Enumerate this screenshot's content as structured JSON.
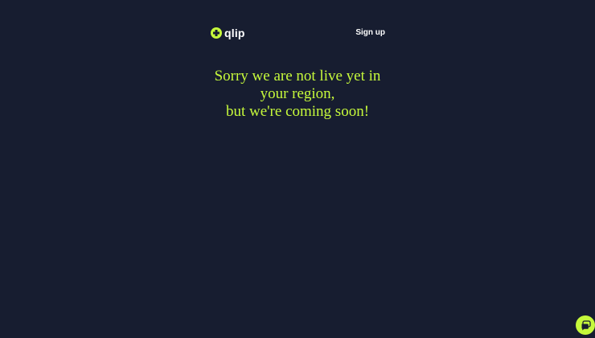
{
  "brand": {
    "name": "qlip",
    "logo_icon": "plus-circle-icon",
    "accent_color": "#c6f93b",
    "background_color": "#171d30"
  },
  "header": {
    "signup_label": "Sign up"
  },
  "message": {
    "line1": "Sorry we are not live yet in",
    "line2": "your region,",
    "line3": "but we're coming soon!"
  },
  "chat_widget": {
    "icon": "chat-bubble-icon"
  }
}
